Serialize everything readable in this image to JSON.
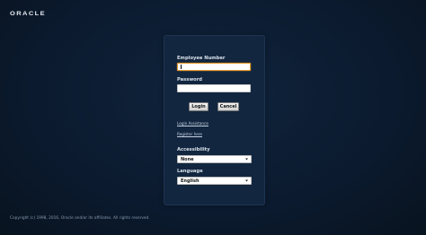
{
  "brand": {
    "logo_text": "ORACLE"
  },
  "login": {
    "employee_number_label": "Employee Number",
    "employee_number_value": "",
    "password_label": "Password",
    "password_value": "",
    "login_button": "Login",
    "cancel_button": "Cancel",
    "login_assistance_link": "Login Assistance",
    "register_link": "Register here",
    "accessibility_label": "Accessibility",
    "accessibility_selected": "None",
    "language_label": "Language",
    "language_selected": "English"
  },
  "footer": {
    "copyright": "Copyright (c) 1998, 2016, Oracle and/or its affiliates. All rights reserved."
  },
  "colors": {
    "background": "#0b1a2e",
    "panel": "#12263f",
    "focus_border": "#e59a2b"
  }
}
